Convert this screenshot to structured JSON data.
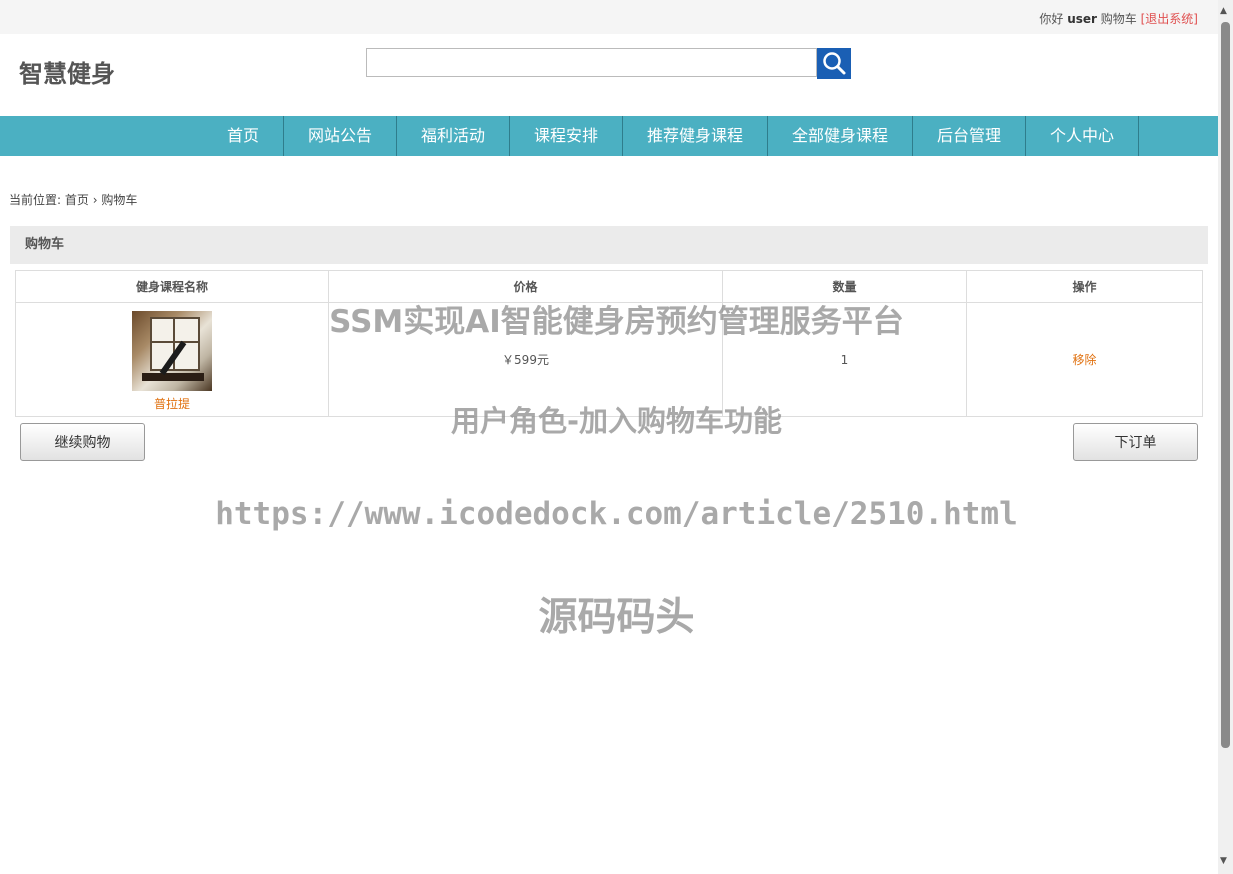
{
  "topbar": {
    "greeting": "你好",
    "username": "user",
    "cart_link": "购物车",
    "logout": "[退出系统]"
  },
  "header": {
    "logo": "智慧健身",
    "search": {
      "value": "",
      "icon": "search-icon"
    }
  },
  "nav": {
    "items": [
      "首页",
      "网站公告",
      "福利活动",
      "课程安排",
      "推荐健身课程",
      "全部健身课程",
      "后台管理",
      "个人中心"
    ]
  },
  "breadcrumb": {
    "prefix": "当前位置:",
    "home": "首页",
    "sep": "›",
    "current": "购物车"
  },
  "cart": {
    "title": "购物车",
    "columns": [
      "健身课程名称",
      "价格",
      "数量",
      "操作"
    ],
    "rows": [
      {
        "name": "普拉提",
        "price": "￥599元",
        "quantity": "1",
        "action": "移除"
      }
    ]
  },
  "buttons": {
    "continue": "继续购物",
    "order": "下订单"
  },
  "watermark": {
    "line1": "SSM实现AI智能健身房预约管理服务平台",
    "line2": "用户角色-加入购物车功能",
    "line3": "https://www.icodedock.com/article/2510.html",
    "line4": "源码码头"
  },
  "colors": {
    "nav_bg": "#4bb0c2",
    "search_btn": "#1a5fb4",
    "link_orange": "#e0700e",
    "logout_red": "#e05050"
  }
}
